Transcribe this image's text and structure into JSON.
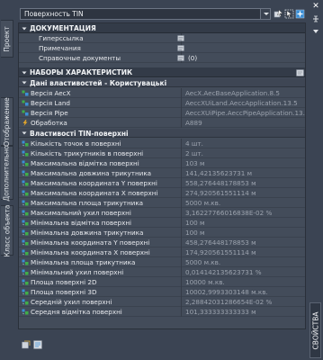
{
  "left_tabs": [
    "Проект",
    "Отображение",
    "Дополнительно",
    "Класс объекта"
  ],
  "combo": {
    "value": "Поверхность TIN"
  },
  "right_tab": "СВОЙСТВА",
  "sections": {
    "documentation": {
      "title": "ДОКУМЕНТАЦИЯ",
      "rows": [
        {
          "label": "Гиперссылка",
          "value": ""
        },
        {
          "label": "Примечания",
          "value": ""
        },
        {
          "label": "Справочные документы",
          "value": "(0)"
        }
      ]
    },
    "property_sets": {
      "title": "НАБОРЫ ХАРАКТЕРИСТИК"
    }
  },
  "group1": {
    "title": "Дані властивостей - Користувацькі",
    "rows": [
      {
        "label": "Версія AecX",
        "value": "AecX.AecBaseApplication.8.5"
      },
      {
        "label": "Версія Land",
        "value": "AeccXUiLand.AeccApplication.13.5"
      },
      {
        "label": "Версія Pipe",
        "value": "AeccXUiPipe.AeccPipeApplication.13.5"
      },
      {
        "label": "Обработка",
        "value": "A889"
      }
    ]
  },
  "group2": {
    "title": "Властивості TIN-поверхні",
    "rows": [
      {
        "label": "Кількість точок в поверхні",
        "value": "4 шт."
      },
      {
        "label": "Кількість трикутників в поверхні",
        "value": "2 шт."
      },
      {
        "label": "Максимальна відмітка поверхні",
        "value": "103 м"
      },
      {
        "label": "Максимальна довжина трикутника",
        "value": "141,42135623731 м"
      },
      {
        "label": "Максимальна координата Y поверхні",
        "value": "558,276448178853 м"
      },
      {
        "label": "Максимальна координата X поверхні",
        "value": "274,920561551114 м"
      },
      {
        "label": "Максимальна площа трикутника",
        "value": "5000 м.кв."
      },
      {
        "label": "Максимальний ухил поверхні",
        "value": "3,16227766016838E-02 %"
      },
      {
        "label": "Мінімальна відмітка поверхні",
        "value": "100 м"
      },
      {
        "label": "Мінімальна довжина трикутника",
        "value": "100 м"
      },
      {
        "label": "Мінімальна координата Y поверхні",
        "value": "458,276448178853 м"
      },
      {
        "label": "Мінімальна координата X поверхні",
        "value": "174,920561551114 м"
      },
      {
        "label": "Мінімальна площа трикутника",
        "value": "5000 м.кв."
      },
      {
        "label": "Мінімальний ухил поверхні",
        "value": "0,014142135623731 %"
      },
      {
        "label": "Площа  поверхні 2D",
        "value": "10000 м.кв."
      },
      {
        "label": "Площа поверхні 3D",
        "value": "10002,9993303148 м.кв."
      },
      {
        "label": "Середній ухил поверхні",
        "value": "2,28842031286654E-02 %"
      },
      {
        "label": "Середня відмітка поверхні",
        "value": "101,333333333333 м"
      }
    ]
  },
  "colors": {
    "panel": "#3b4453",
    "grid": "#434c5a",
    "section": "#333b48",
    "value_text": "#9ba2ad",
    "icon_green": "#3fae49",
    "icon_blue": "#3b8fd6"
  }
}
